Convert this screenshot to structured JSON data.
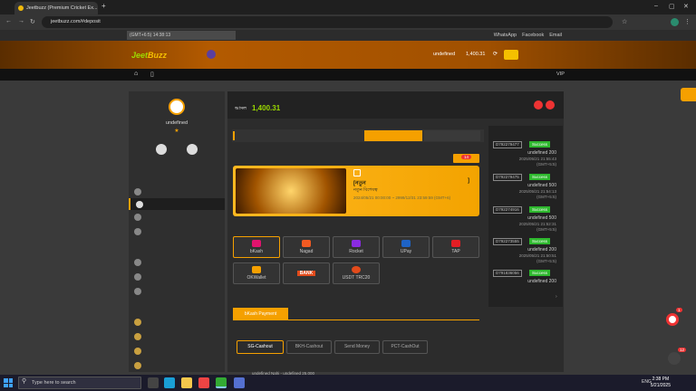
{
  "browser": {
    "tab_title": "Jeetbuzz (Premium Cricket Ex...",
    "url": "jeetbuzz.com/#deposit"
  },
  "utility": {
    "time": "(GMT+6:5) 14:38:13",
    "whatsapp": "WhatsApp",
    "facebook": "Facebook",
    "email": "Email"
  },
  "header": {
    "logo_a": "Jeet",
    "logo_b": "Buzz",
    "username": "undefined",
    "balance": "1,400.31"
  },
  "menu": {
    "vip": "VIP"
  },
  "sidebar": {
    "username": "undefined",
    "star": "★"
  },
  "main": {
    "balance_label": "আসল",
    "balance": "1,400.31",
    "promo_badge": "14",
    "promo_title": "[নতুন",
    "promo_bracket": "]",
    "promo_subtitle": "নতুন বিশেষত্ব",
    "promo_dates": "2024/05/21 00:00:00 ~ 2999/12/31 23:59:59 (GMT+6)"
  },
  "payments": [
    {
      "label": "bKash",
      "color": "#e2136e"
    },
    {
      "label": "Nagad",
      "color": "#f15a22"
    },
    {
      "label": "Rocket",
      "color": "#8a2be2"
    },
    {
      "label": "UPay",
      "color": "#1e63c6"
    },
    {
      "label": "TAP",
      "color": "#e31e24"
    },
    {
      "label": "OKWallet",
      "color": "#f5a000"
    },
    {
      "label": "BANK",
      "color": "#e34b1b"
    },
    {
      "label": "USDT TRC20",
      "color": "#e34b1b"
    }
  ],
  "channel": {
    "tab": "bKash Payment",
    "options": [
      "SG-Cashout",
      "BKH-Cashout",
      "Send Money",
      "PCT-CashOut"
    ],
    "footnote": "undefined Nahi - undefined 25,000"
  },
  "records": [
    {
      "id": "D792279477",
      "status": "Success",
      "amount": "undefined 200",
      "time": "2025/05/21 21:55:43",
      "tz": "(GMT+5:5)"
    },
    {
      "id": "D792279475",
      "status": "Success",
      "amount": "undefined 500",
      "time": "2025/05/21 21:54:13",
      "tz": "(GMT+5:5)"
    },
    {
      "id": "D792274916",
      "status": "Success",
      "amount": "undefined 500",
      "time": "2025/05/21 21:52:31",
      "tz": "(GMT+5:5)"
    },
    {
      "id": "D792273555",
      "status": "Success",
      "amount": "undefined 200",
      "time": "2025/05/21 21:50:51",
      "tz": "(GMT+5:5)"
    },
    {
      "id": "D791836056",
      "status": "Success",
      "amount": "undefined 200",
      "time": "",
      "tz": ""
    }
  ],
  "taskbar": {
    "search": "Type here to search",
    "lang": "ENG",
    "time": "2:38 PM",
    "date": "5/21/2025"
  },
  "widgets": {
    "chat_badge": "1",
    "chat2_badge": "12"
  }
}
